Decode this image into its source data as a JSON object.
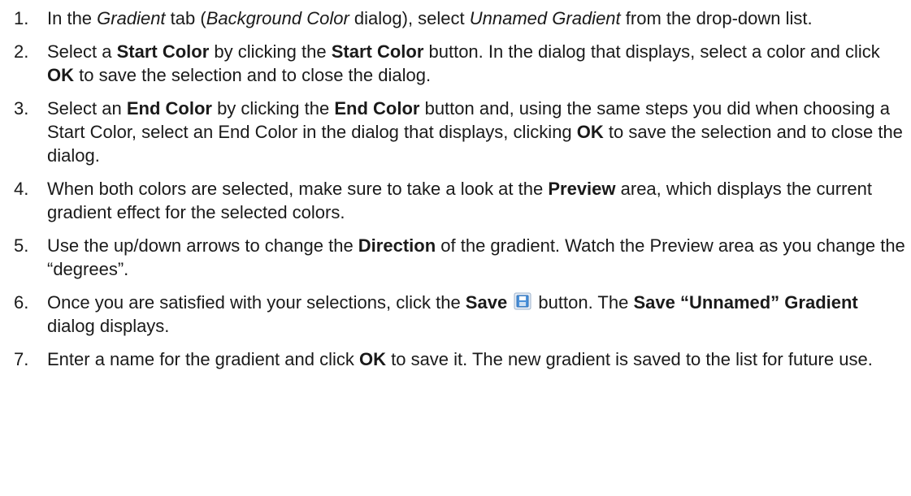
{
  "steps": [
    {
      "num": "1.",
      "parts": [
        {
          "t": "In the "
        },
        {
          "t": "Gradient",
          "i": true
        },
        {
          "t": " tab ("
        },
        {
          "t": "Background Color",
          "i": true
        },
        {
          "t": " dialog), select "
        },
        {
          "t": "Unnamed Gradient",
          "i": true
        },
        {
          "t": " from the drop-down list."
        }
      ]
    },
    {
      "num": "2.",
      "parts": [
        {
          "t": "Select a "
        },
        {
          "t": "Start Color",
          "b": true
        },
        {
          "t": " by clicking the "
        },
        {
          "t": "Start Color",
          "b": true
        },
        {
          "t": " button. In the dialog that displays, select a color and click "
        },
        {
          "t": "OK",
          "b": true
        },
        {
          "t": " to save the selection and to close the dialog."
        }
      ]
    },
    {
      "num": "3.",
      "parts": [
        {
          "t": "Select an "
        },
        {
          "t": "End Color",
          "b": true
        },
        {
          "t": " by clicking the "
        },
        {
          "t": "End Color",
          "b": true
        },
        {
          "t": " button and, using the same steps you did when choosing a Start Color, select an End Color in the dialog that displays, clicking "
        },
        {
          "t": "OK",
          "b": true
        },
        {
          "t": " to save the selection and to close the dialog."
        }
      ]
    },
    {
      "num": "4.",
      "parts": [
        {
          "t": "When both colors are selected, make sure to take a look at the "
        },
        {
          "t": "Preview",
          "b": true
        },
        {
          "t": " area, which displays the current gradient effect for the selected colors."
        }
      ]
    },
    {
      "num": "5.",
      "parts": [
        {
          "t": "Use the up/down arrows to change the "
        },
        {
          "t": "Direction",
          "b": true
        },
        {
          "t": " of the gradient. Watch the Preview area as you change the “degrees”."
        }
      ]
    },
    {
      "num": "6.",
      "parts": [
        {
          "t": "Once you are satisfied with your selections, click the "
        },
        {
          "t": "Save",
          "b": true
        },
        {
          "icon": "save-icon"
        },
        {
          "t": " button. The "
        },
        {
          "t": "Save “Unnamed” Gradient",
          "b": true
        },
        {
          "t": " dialog displays."
        }
      ]
    },
    {
      "num": "7.",
      "parts": [
        {
          "t": "Enter a name for the gradient and click "
        },
        {
          "t": "OK",
          "b": true
        },
        {
          "t": " to save it. The new gradient is saved to the list for future use."
        }
      ]
    }
  ],
  "colors": {
    "text": "#1a1a1a",
    "save_icon_fill": "#4a90d9",
    "save_icon_border": "#2e6fb5"
  }
}
